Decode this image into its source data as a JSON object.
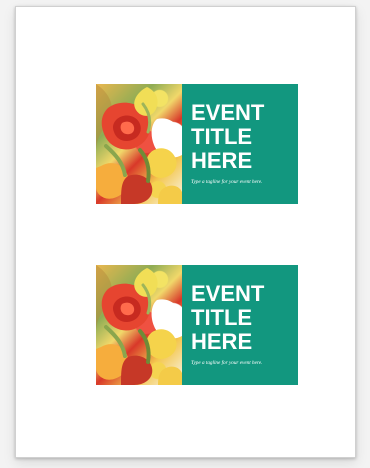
{
  "document": {
    "cards": [
      {
        "title_lines": [
          "EVENT",
          "TITLE",
          "HERE"
        ],
        "tagline": "Type a tagline for your event here."
      },
      {
        "title_lines": [
          "EVENT",
          "TITLE",
          "HERE"
        ],
        "tagline": "Type a tagline for your event here."
      }
    ]
  },
  "colors": {
    "page_background": "#f3f3f3",
    "paper": "#ffffff",
    "card_panel": "#12977f",
    "text": "#ffffff",
    "flower_red": "#ef4c3b",
    "flower_yellow": "#f5d34b"
  },
  "images": {
    "card_photo": "rose-bouquet-photo"
  }
}
